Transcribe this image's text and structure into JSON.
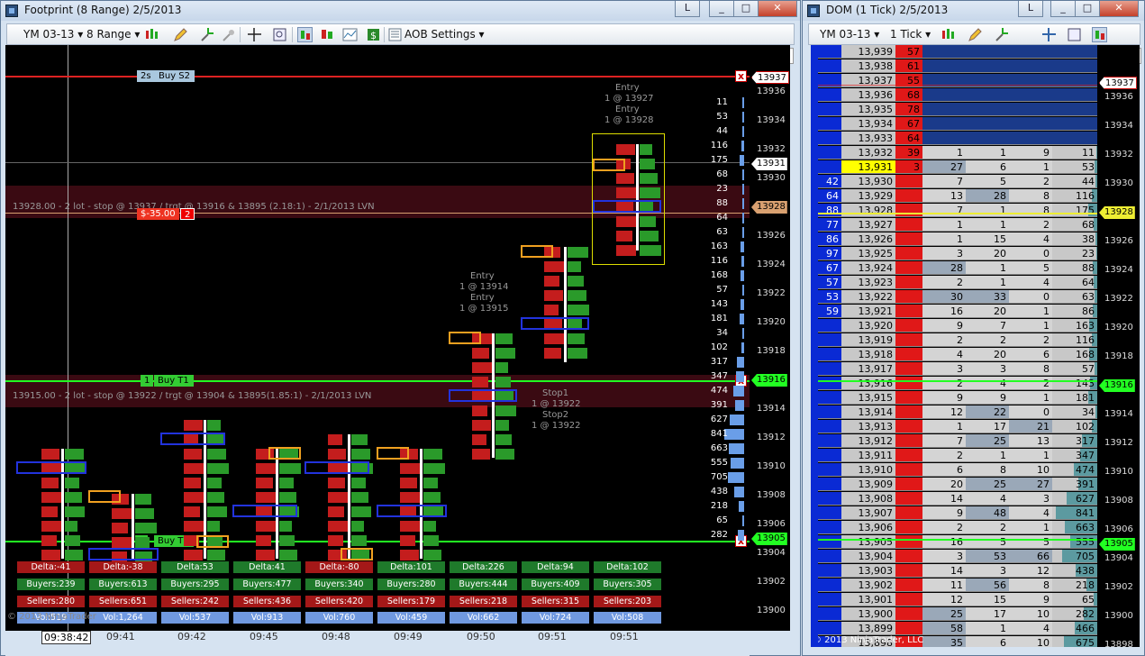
{
  "footprint": {
    "title": "Footprint (8 Range)  2/5/2013",
    "instrument": "YM 03-13",
    "period": "8 Range",
    "aob_settings": "AOB Settings",
    "price_axis": [
      "13936",
      "13934",
      "13932",
      "13930",
      "13928",
      "13926",
      "13924",
      "13922",
      "13920",
      "13918",
      "13916",
      "13914",
      "13912",
      "13910",
      "13908",
      "13906",
      "13904",
      "13902",
      "13900"
    ],
    "marker_13937": "13937",
    "marker_13931": "13931",
    "marker_13928": "13928",
    "marker_13916": "13916",
    "marker_13905": "13905",
    "time_labels": [
      "09:41",
      "09:42",
      "09:45",
      "09:48",
      "09:49",
      "09:50",
      "09:51",
      "09:51"
    ],
    "crosshair_time": "09:38:42",
    "orders": {
      "s2_qty": "2s",
      "s2_label": "Buy S2",
      "t1_qty": "1",
      "t1_label": "Buy T1",
      "t2_qty": "1",
      "t2_label": "Buy T2",
      "pnl": "$-35.00",
      "pnl_qty": "2"
    },
    "notes": {
      "note1": "13928.00 - 2 lot - stop @ 13937 / trgt @ 13916 & 13895 (2.18:1) - 2/1/2013 LVN",
      "note2": "13915.00 - 2 lot - stop @ 13922 / trgt @ 13904 & 13895(1.85:1) - 2/1/2013 LVN"
    },
    "annotations": {
      "entry_a1": "Entry",
      "entry_a2": "1 @ 13927",
      "entry_a3": "Entry",
      "entry_a4": "1 @ 13928",
      "entry_b1": "Entry",
      "entry_b2": "1 @ 13914",
      "entry_b3": "Entry",
      "entry_b4": "1 @ 13915",
      "stop1": "Stop1",
      "stop1b": "1 @ 13922",
      "stop2": "Stop2",
      "stop2b": "1 @ 13922"
    },
    "summary": {
      "delta": [
        "Delta:-41",
        "Delta:-38",
        "Delta:53",
        "Delta:41",
        "Delta:-80",
        "Delta:101",
        "Delta:226",
        "Delta:94",
        "Delta:102"
      ],
      "buyers": [
        "Buyers:239",
        "Buyers:613",
        "Buyers:295",
        "Buyers:477",
        "Buyers:340",
        "Buyers:280",
        "Buyers:444",
        "Buyers:409",
        "Buyers:305"
      ],
      "sellers": [
        "Sellers:280",
        "Sellers:651",
        "Sellers:242",
        "Sellers:436",
        "Sellers:420",
        "Sellers:179",
        "Sellers:218",
        "Sellers:315",
        "Sellers:203"
      ],
      "vol": [
        "Vol:519",
        "Vol:1,264",
        "Vol:537",
        "Vol:913",
        "Vol:760",
        "Vol:459",
        "Vol:662",
        "Vol:724",
        "Vol:508"
      ]
    },
    "profile": [
      "11",
      "53",
      "44",
      "116",
      "175",
      "68",
      "23",
      "88",
      "64",
      "63",
      "163",
      "116",
      "168",
      "57",
      "143",
      "181",
      "34",
      "102",
      "317",
      "347",
      "474",
      "391",
      "627",
      "841",
      "663",
      "555",
      "705",
      "438",
      "218",
      "65",
      "282"
    ],
    "copyright": "© 2013 NinjaTrader"
  },
  "dom": {
    "title": "DOM (1 Tick)  2/5/2013",
    "instrument": "YM 03-13",
    "period": "1 Tick",
    "copyright": "© 2013 NinjaTrader, LLC",
    "rows": [
      [
        "",
        "13,939",
        "57",
        "",
        "",
        "",
        ""
      ],
      [
        "",
        "13,938",
        "61",
        "",
        "",
        "",
        ""
      ],
      [
        "",
        "13,937",
        "55",
        "",
        "",
        "",
        ""
      ],
      [
        "",
        "13,936",
        "68",
        "",
        "",
        "",
        ""
      ],
      [
        "",
        "13,935",
        "78",
        "",
        "",
        "",
        ""
      ],
      [
        "",
        "13,934",
        "67",
        "",
        "",
        "",
        ""
      ],
      [
        "",
        "13,933",
        "64",
        "",
        "",
        "",
        ""
      ],
      [
        "",
        "13,932",
        "39",
        "1",
        "1",
        "9",
        "11"
      ],
      [
        "",
        "13,931",
        "3",
        "27",
        "6",
        "1",
        "53"
      ],
      [
        "42",
        "13,930",
        "",
        "7",
        "5",
        "2",
        "44"
      ],
      [
        "64",
        "13,929",
        "",
        "13",
        "28",
        "8",
        "116"
      ],
      [
        "88",
        "13,928",
        "",
        "7",
        "1",
        "8",
        "175"
      ],
      [
        "77",
        "13,927",
        "",
        "1",
        "1",
        "2",
        "68"
      ],
      [
        "86",
        "13,926",
        "",
        "1",
        "15",
        "4",
        "38"
      ],
      [
        "97",
        "13,925",
        "",
        "3",
        "20",
        "0",
        "23"
      ],
      [
        "67",
        "13,924",
        "",
        "28",
        "1",
        "5",
        "88"
      ],
      [
        "57",
        "13,923",
        "",
        "2",
        "1",
        "4",
        "64"
      ],
      [
        "53",
        "13,922",
        "",
        "30",
        "33",
        "0",
        "63"
      ],
      [
        "59",
        "13,921",
        "",
        "16",
        "20",
        "1",
        "86"
      ],
      [
        "",
        "13,920",
        "",
        "9",
        "7",
        "1",
        "163"
      ],
      [
        "",
        "13,919",
        "",
        "2",
        "2",
        "2",
        "116"
      ],
      [
        "",
        "13,918",
        "",
        "4",
        "20",
        "6",
        "168"
      ],
      [
        "",
        "13,917",
        "",
        "3",
        "3",
        "8",
        "57"
      ],
      [
        "",
        "13,916",
        "",
        "2",
        "4",
        "2",
        "143"
      ],
      [
        "",
        "13,915",
        "",
        "9",
        "9",
        "1",
        "181"
      ],
      [
        "",
        "13,914",
        "",
        "12",
        "22",
        "0",
        "34"
      ],
      [
        "",
        "13,913",
        "",
        "1",
        "17",
        "21",
        "102"
      ],
      [
        "",
        "13,912",
        "",
        "7",
        "25",
        "13",
        "317"
      ],
      [
        "",
        "13,911",
        "",
        "2",
        "1",
        "1",
        "347"
      ],
      [
        "",
        "13,910",
        "",
        "6",
        "8",
        "10",
        "474"
      ],
      [
        "",
        "13,909",
        "",
        "20",
        "25",
        "27",
        "391"
      ],
      [
        "",
        "13,908",
        "",
        "14",
        "4",
        "3",
        "627"
      ],
      [
        "",
        "13,907",
        "",
        "9",
        "48",
        "4",
        "841"
      ],
      [
        "",
        "13,906",
        "",
        "2",
        "2",
        "1",
        "663"
      ],
      [
        "",
        "13,905",
        "",
        "16",
        "5",
        "5",
        "555"
      ],
      [
        "",
        "13,904",
        "",
        "3",
        "53",
        "66",
        "705"
      ],
      [
        "",
        "13,903",
        "",
        "14",
        "3",
        "12",
        "438"
      ],
      [
        "",
        "13,902",
        "",
        "11",
        "56",
        "8",
        "218"
      ],
      [
        "",
        "13,901",
        "",
        "12",
        "15",
        "9",
        "65"
      ],
      [
        "",
        "13,900",
        "",
        "25",
        "17",
        "10",
        "282"
      ],
      [
        "",
        "13,899",
        "",
        "58",
        "1",
        "4",
        "466"
      ],
      [
        "",
        "13,898",
        "",
        "35",
        "6",
        "10",
        "675"
      ]
    ],
    "axis": [
      "13937",
      "13936",
      "13934",
      "13932",
      "13930",
      "13928",
      "13926",
      "13924",
      "13922",
      "13920",
      "13918",
      "13916",
      "13914",
      "13912",
      "13910",
      "13908",
      "13906",
      "13905",
      "13904",
      "13902",
      "13900",
      "13898"
    ]
  }
}
